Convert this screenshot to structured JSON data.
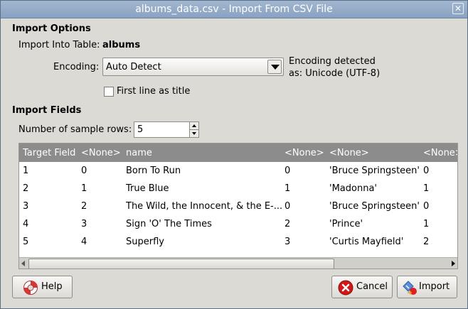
{
  "window": {
    "title": "albums_data.csv - Import From CSV File",
    "close_glyph": "✕"
  },
  "import_options": {
    "header": "Import Options",
    "import_into_label": "Import Into Table:",
    "table_name": "albums",
    "encoding_label": "Encoding:",
    "encoding_value": "Auto Detect",
    "encoding_detected_line1": "Encoding detected",
    "encoding_detected_line2": "as: Unicode (UTF-8)",
    "first_line_label": "First line as title",
    "first_line_checked": false
  },
  "import_fields": {
    "header": "Import Fields",
    "sample_rows_label": "Number of sample rows:",
    "sample_rows_value": "5"
  },
  "table": {
    "columns": [
      "Target Field",
      "<None>",
      "name",
      "<None>",
      "<None>",
      "<None>"
    ],
    "rows": [
      [
        "1",
        "0",
        "Born To Run",
        "0",
        "'Bruce Springsteen'",
        "0"
      ],
      [
        "2",
        "1",
        "True Blue",
        "1",
        "'Madonna'",
        "1"
      ],
      [
        "3",
        "2",
        "The Wild, the Innocent, & the E-...",
        "0",
        "'Bruce Springsteen'",
        "0"
      ],
      [
        "4",
        "3",
        "Sign 'O' The Times",
        "2",
        "'Prince'",
        "1"
      ],
      [
        "5",
        "4",
        "Superfly",
        "3",
        "'Curtis Mayfield'",
        "2"
      ]
    ]
  },
  "buttons": {
    "help": "Help",
    "cancel": "Cancel",
    "import": "Import"
  },
  "colors": {
    "titlebar": "#8aa2c2",
    "table_header": "#8c8c8c",
    "window_bg": "#dcdad5"
  }
}
